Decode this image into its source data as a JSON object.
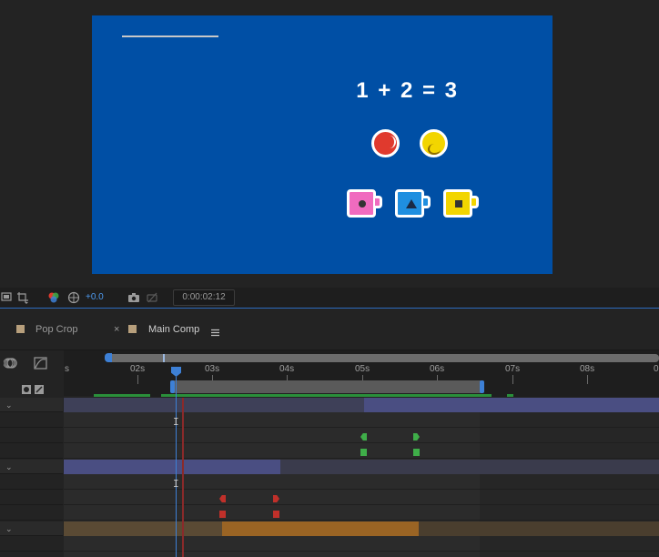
{
  "colors": {
    "comp_bg": "#004fa5",
    "ball_red": "#e03a2e",
    "ball_yellow": "#f2d500",
    "mug_pink": "#f06bbf",
    "mug_blue": "#1f8fe0",
    "mug_yellow": "#f2d500",
    "accent": "#3d80d6",
    "layer_bar_blue": "#4a4e82",
    "layer_bar_orange": "#9a6424",
    "keyframe_green": "#3fae49",
    "keyframe_red": "#c0302a"
  },
  "viewer": {
    "equation": "1 + 2 = 3",
    "exposure": "+0.0",
    "timecode": "0:00:02:12"
  },
  "timeline": {
    "tabs": [
      {
        "label": "Pop Crop"
      },
      {
        "label": "Main Comp",
        "active": true
      }
    ],
    "ruler": [
      "s",
      "02s",
      "03s",
      "04s",
      "05s",
      "06s",
      "07s",
      "08s",
      "0"
    ]
  }
}
